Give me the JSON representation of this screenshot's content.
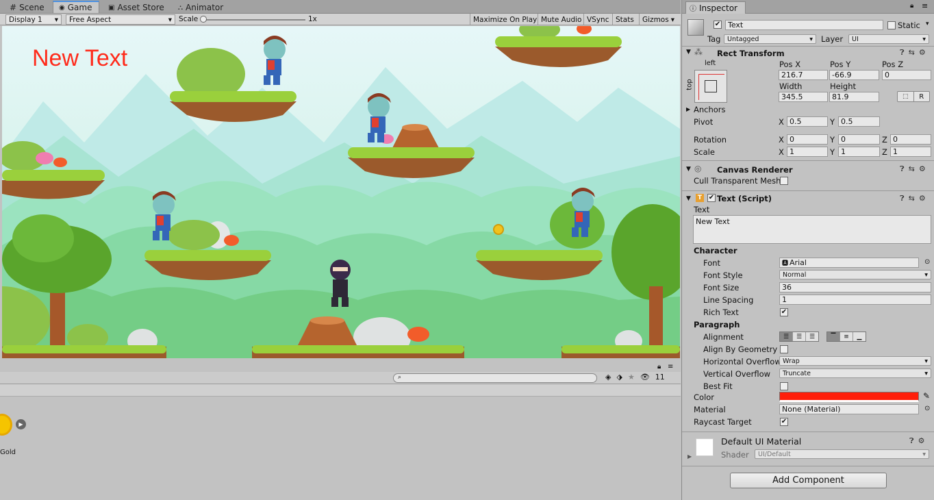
{
  "tabs": [
    {
      "label": "Scene",
      "icon": "hash-icon"
    },
    {
      "label": "Game",
      "icon": "game-icon"
    },
    {
      "label": "Asset Store",
      "icon": "store-icon"
    },
    {
      "label": "Animator",
      "icon": "animator-icon"
    }
  ],
  "game_toolbar": {
    "display": "Display 1",
    "aspect": "Free Aspect",
    "scale_label": "Scale",
    "scale_value": "1x",
    "maximize": "Maximize On Play",
    "mute": "Mute Audio",
    "vsync": "VSync",
    "stats": "Stats",
    "gizmos": "Gizmos"
  },
  "game_view": {
    "ui_text": "New Text",
    "ui_text_color": "#ff2a1a"
  },
  "project": {
    "count": "11",
    "asset_label": "Gold"
  },
  "inspector": {
    "tab": "Inspector",
    "object_name": "Text",
    "static_label": "Static",
    "tag_label": "Tag",
    "tag_value": "Untagged",
    "layer_label": "Layer",
    "layer_value": "UI",
    "rect_transform": {
      "title": "Rect Transform",
      "anchor_h": "left",
      "anchor_v": "top",
      "pos_x_label": "Pos X",
      "pos_y_label": "Pos Y",
      "pos_z_label": "Pos Z",
      "pos_x": "216.7",
      "pos_y": "-66.9",
      "pos_z": "0",
      "width_label": "Width",
      "height_label": "Height",
      "width": "345.5",
      "height": "81.9",
      "r_button": "R",
      "anchors_label": "Anchors",
      "pivot_label": "Pivot",
      "pivot_x": "0.5",
      "pivot_y": "0.5",
      "rotation_label": "Rotation",
      "rot_x": "0",
      "rot_y": "0",
      "rot_z": "0",
      "scale_label": "Scale",
      "scale_x": "1",
      "scale_y": "1",
      "scale_z": "1",
      "x": "X",
      "y": "Y",
      "z": "Z"
    },
    "canvas_renderer": {
      "title": "Canvas Renderer",
      "cull_label": "Cull Transparent Mesh"
    },
    "text_script": {
      "title": "Text (Script)",
      "text_label": "Text",
      "text_value": "New Text",
      "character_label": "Character",
      "font_label": "Font",
      "font_value": "Arial",
      "font_style_label": "Font Style",
      "font_style_value": "Normal",
      "font_size_label": "Font Size",
      "font_size_value": "36",
      "line_spacing_label": "Line Spacing",
      "line_spacing_value": "1",
      "rich_text_label": "Rich Text",
      "paragraph_label": "Paragraph",
      "alignment_label": "Alignment",
      "align_geometry_label": "Align By Geometry",
      "h_overflow_label": "Horizontal Overflow",
      "h_overflow_value": "Wrap",
      "v_overflow_label": "Vertical Overflow",
      "v_overflow_value": "Truncate",
      "best_fit_label": "Best Fit",
      "color_label": "Color",
      "color_value": "#ff1e0a",
      "material_label": "Material",
      "material_value": "None (Material)",
      "raycast_label": "Raycast Target"
    },
    "material_block": {
      "title": "Default UI Material",
      "shader_label": "Shader",
      "shader_value": "UI/Default"
    },
    "add_component": "Add Component"
  }
}
